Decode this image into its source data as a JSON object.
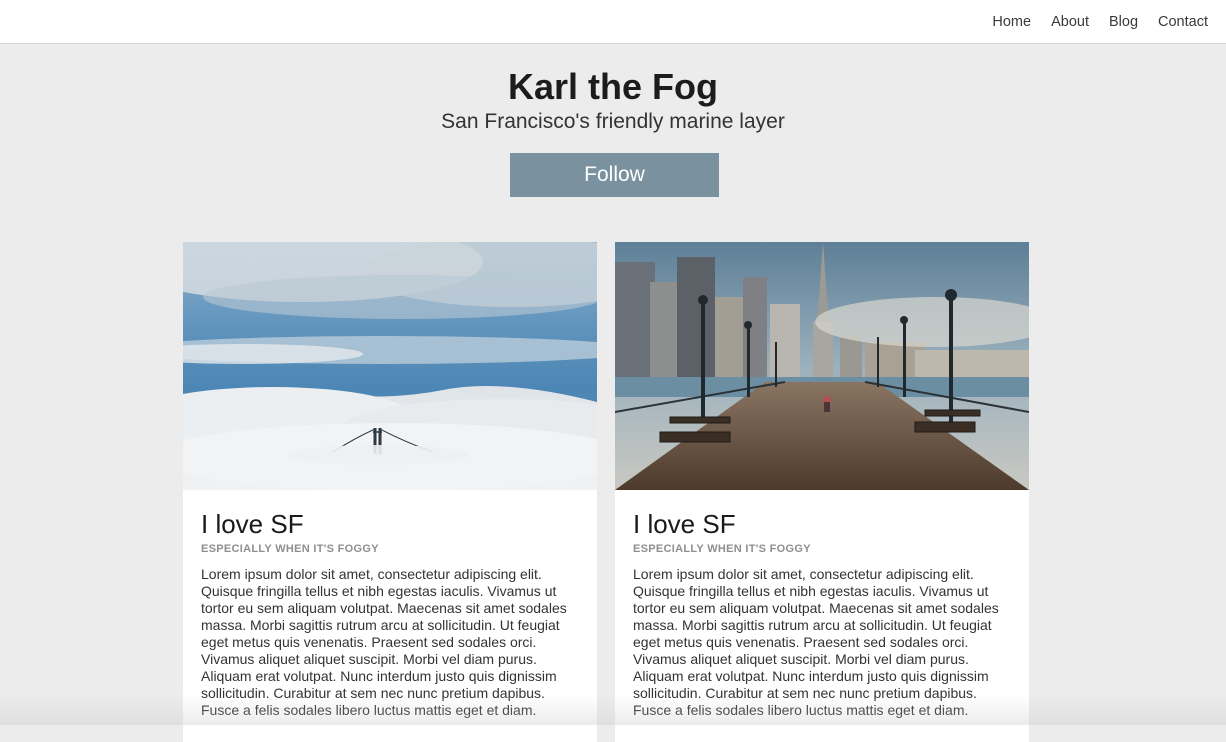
{
  "nav": {
    "items": [
      {
        "label": "Home"
      },
      {
        "label": "About"
      },
      {
        "label": "Blog"
      },
      {
        "label": "Contact"
      }
    ]
  },
  "hero": {
    "title": "Karl the Fog",
    "subtitle": "San Francisco's friendly marine layer",
    "follow_label": "Follow"
  },
  "cards": [
    {
      "title": "I love SF",
      "kicker": "ESPECIALLY WHEN IT'S FOGGY",
      "body": "Lorem ipsum dolor sit amet, consectetur adipiscing elit. Quisque fringilla tellus et nibh egestas iaculis. Vivamus ut tortor eu sem aliquam volutpat. Maecenas sit amet sodales massa. Morbi sagittis rutrum arcu at sollicitudin. Ut feugiat eget metus quis venenatis. Praesent sed sodales orci. Vivamus aliquet aliquet suscipit. Morbi vel diam purus. Aliquam erat volutpat. Nunc interdum justo quis dignissim sollicitudin. Curabitur at sem nec nunc pretium dapibus. Fusce a felis sodales libero luctus mattis eget et diam."
    },
    {
      "title": "I love SF",
      "kicker": "ESPECIALLY WHEN IT'S FOGGY",
      "body": "Lorem ipsum dolor sit amet, consectetur adipiscing elit. Quisque fringilla tellus et nibh egestas iaculis. Vivamus ut tortor eu sem aliquam volutpat. Maecenas sit amet sodales massa. Morbi sagittis rutrum arcu at sollicitudin. Ut feugiat eget metus quis venenatis. Praesent sed sodales orci. Vivamus aliquet aliquet suscipit. Morbi vel diam purus. Aliquam erat volutpat. Nunc interdum justo quis dignissim sollicitudin. Curabitur at sem nec nunc pretium dapibus. Fusce a felis sodales libero luctus mattis eget et diam."
    }
  ],
  "colors": {
    "page_bg": "#ececec",
    "follow_button": "#7a929f",
    "kicker": "#8f8f8f"
  }
}
